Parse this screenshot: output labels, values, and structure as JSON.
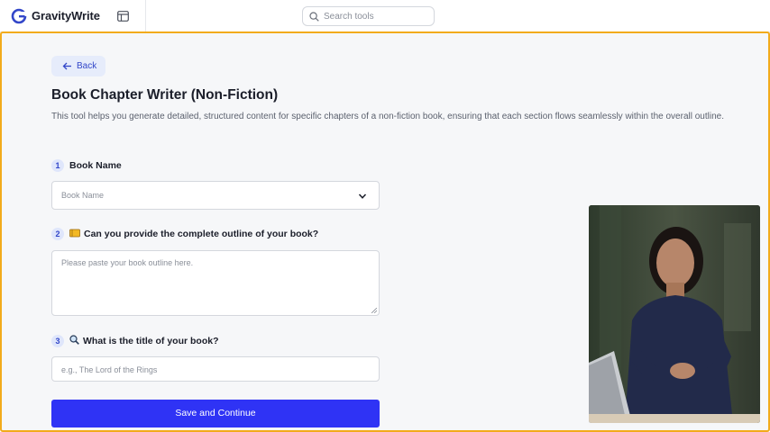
{
  "header": {
    "app_name": "GravityWrite",
    "search_placeholder": "Search tools"
  },
  "main": {
    "back_label": "Back",
    "title": "Book Chapter Writer (Non-Fiction)",
    "description": "This tool helps you generate detailed, structured content for specific chapters of a non-fiction book, ensuring that each section flows seamlessly within the overall outline.",
    "steps": [
      {
        "number": "1",
        "emoji": "",
        "label": "Book Name",
        "placeholder": "Book Name"
      },
      {
        "number": "2",
        "emoji": "📒",
        "label": "Can you provide the complete outline of your book?",
        "placeholder": "Please paste your book outline here."
      },
      {
        "number": "3",
        "emoji": "🔍",
        "label": "What is the title of your book?",
        "placeholder": "e.g., The Lord of the Rings"
      }
    ],
    "save_label": "Save and Continue"
  },
  "colors": {
    "brand": "#2f33f5",
    "highlight_border": "#f2ab1c",
    "accent_text": "#3347c9"
  },
  "icons": [
    "gravitywrite-logo",
    "panel-icon",
    "search-icon",
    "arrow-left-icon",
    "chevron-down-icon",
    "notebook-emoji",
    "magnifier-emoji"
  ]
}
